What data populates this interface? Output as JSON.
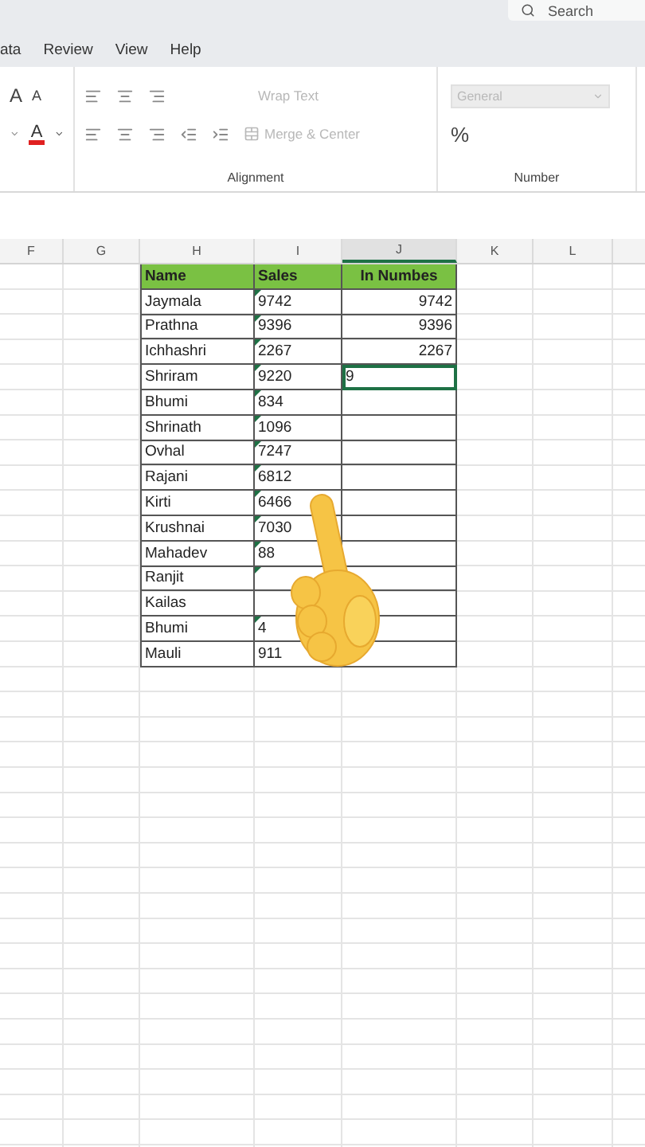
{
  "title_bar": {
    "search": {
      "placeholder": "Search"
    }
  },
  "menu_tabs": [
    {
      "label": "ata",
      "selected": false
    },
    {
      "label": "Review",
      "selected": false
    },
    {
      "label": "View",
      "selected": false
    },
    {
      "label": "Help",
      "selected": false
    }
  ],
  "ribbon": {
    "font": {
      "grow": "A",
      "shrink": "A",
      "color_label": "A",
      "color": "#e02020"
    },
    "alignment": {
      "label": "Alignment",
      "wrap_text": {
        "label": "Wrap Text",
        "disabled": true
      },
      "merge": {
        "label": "Merge & Center",
        "disabled": true
      }
    },
    "number": {
      "label": "Number",
      "format": {
        "value": "General",
        "disabled": true
      },
      "percent": "%"
    }
  },
  "columns": [
    {
      "label": "F",
      "selected": false
    },
    {
      "label": "G",
      "selected": false
    },
    {
      "label": "H",
      "selected": false
    },
    {
      "label": "I",
      "selected": false
    },
    {
      "label": "J",
      "selected": true
    },
    {
      "label": "K",
      "selected": false
    },
    {
      "label": "L",
      "selected": false
    }
  ],
  "table": {
    "headers": [
      "Name",
      "Sales",
      "In Numbes"
    ],
    "rows": [
      {
        "name": "Jaymala",
        "sales": "9742",
        "in_numbers": "9742",
        "flag": true,
        "active": false
      },
      {
        "name": "Prathna",
        "sales": "9396",
        "in_numbers": "9396",
        "flag": true,
        "active": false
      },
      {
        "name": "Ichhashri",
        "sales": "2267",
        "in_numbers": "2267",
        "flag": true,
        "active": false
      },
      {
        "name": "Shriram",
        "sales": "9220",
        "in_numbers": "9",
        "flag": true,
        "active": true
      },
      {
        "name": "Bhumi",
        "sales": "834",
        "flag": true,
        "active": false
      },
      {
        "name": "Shrinath",
        "sales": "1096",
        "flag": true,
        "active": false
      },
      {
        "name": "Ovhal",
        "sales": "7247",
        "flag": true,
        "active": false
      },
      {
        "name": "Rajani",
        "sales": "6812",
        "flag": true,
        "active": false
      },
      {
        "name": "Kirti",
        "sales": "6466",
        "flag": true,
        "active": false
      },
      {
        "name": "Krushnai",
        "sales": "7030",
        "flag": true,
        "active": false
      },
      {
        "name": "Mahadev",
        "sales": "88",
        "flag": true,
        "active": false
      },
      {
        "name": "Ranjit",
        "flag": true,
        "active": false
      },
      {
        "name": "Kailas",
        "flag": false,
        "active": false
      },
      {
        "name": "Bhumi",
        "sales": "4",
        "flag": true,
        "active": false
      },
      {
        "name": "Mauli",
        "sales": "911",
        "flag": false,
        "active": false
      }
    ]
  }
}
